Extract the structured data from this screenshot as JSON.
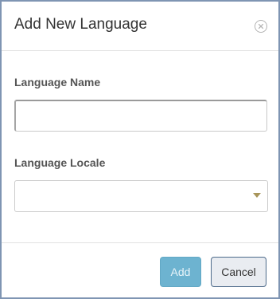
{
  "dialog": {
    "title": "Add New Language",
    "close_icon": "close-circle-icon"
  },
  "form": {
    "language_name": {
      "label": "Language Name",
      "value": "",
      "placeholder": ""
    },
    "language_locale": {
      "label": "Language Locale",
      "selected": "",
      "caret_icon": "caret-down-icon",
      "caret_color": "#a8955a"
    }
  },
  "footer": {
    "add_label": "Add",
    "cancel_label": "Cancel"
  },
  "colors": {
    "border": "#7f95b3",
    "add_button": "#6db3d0",
    "cancel_button": "#e9ecf1"
  }
}
